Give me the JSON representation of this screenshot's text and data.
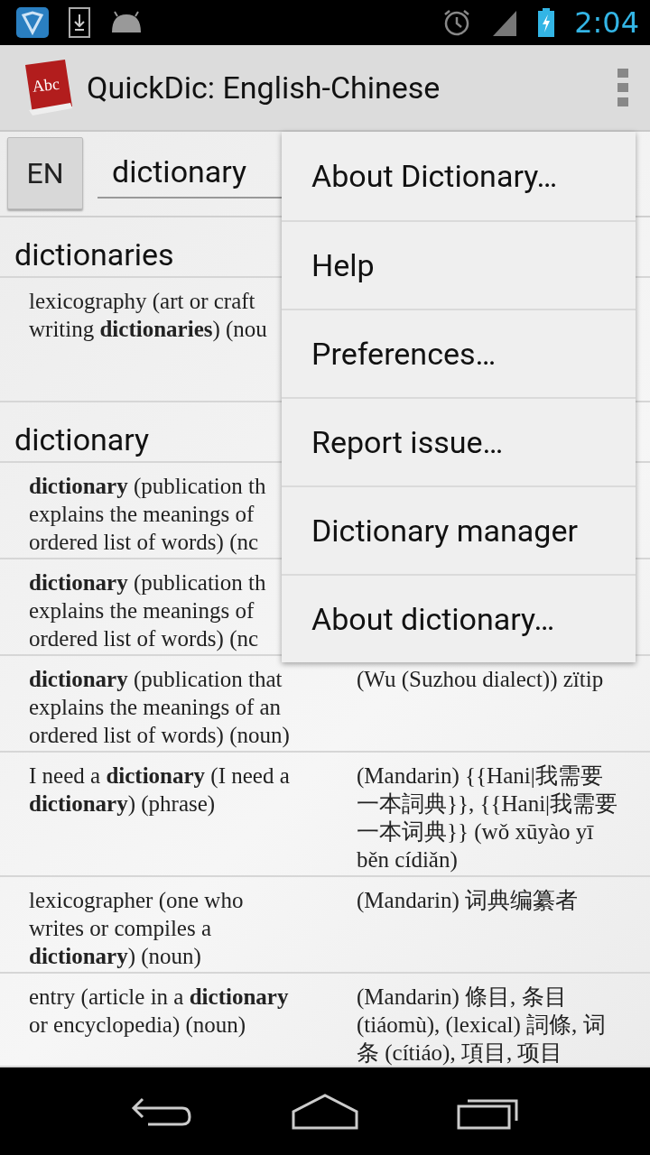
{
  "status_bar": {
    "time": "2:04"
  },
  "action_bar": {
    "title": "QuickDic: English-Chinese",
    "logo_text": "Abc"
  },
  "search": {
    "language_button": "EN",
    "value": "dictionary"
  },
  "entries": [
    {
      "kind": "header",
      "text": "dictionaries"
    },
    {
      "kind": "entry",
      "left": [
        "lexicography (art or craft",
        "writing **dictionaries**) (nou"
      ]
    },
    {
      "kind": "header",
      "text": "dictionary"
    },
    {
      "kind": "entry",
      "left": [
        "**dictionary** (publication th",
        "explains the meanings of",
        "ordered list of words) (nc"
      ]
    },
    {
      "kind": "entry",
      "left": [
        "**dictionary** (publication th",
        "explains the meanings of",
        "ordered list of words) (nc"
      ]
    },
    {
      "kind": "entry",
      "left": [
        "**dictionary** (publication that",
        "explains the meanings of an",
        "ordered list of words) (noun)"
      ],
      "right": [
        "(Wu (Suzhou dialect)) zïtip"
      ]
    },
    {
      "kind": "entry",
      "left": [
        "I need a **dictionary** (I need a",
        "**dictionary**) (phrase)"
      ],
      "right": [
        "(Mandarin) {{Hani|我需要",
        "一本詞典}}, {{Hani|我需要",
        "一本词典}} (wǒ xūyào yī",
        "běn cídiǎn)"
      ]
    },
    {
      "kind": "entry",
      "left": [
        "lexicographer (one who",
        "writes or compiles a",
        "**dictionary**) (noun)"
      ],
      "right": [
        "(Mandarin) 词典编纂者"
      ]
    },
    {
      "kind": "entry",
      "left": [
        "entry (article in a **dictionary**",
        "or encyclopedia) (noun)"
      ],
      "right": [
        "(Mandarin) 條目, 条目",
        "(tiáomù), (lexical) 詞條, 词",
        "条 (cítiáo), 項目, 项目"
      ]
    }
  ],
  "menu": {
    "items": [
      "About Dictionary…",
      "Help",
      "Preferences…",
      "Report issue…",
      "Dictionary manager",
      "About dictionary…"
    ]
  }
}
